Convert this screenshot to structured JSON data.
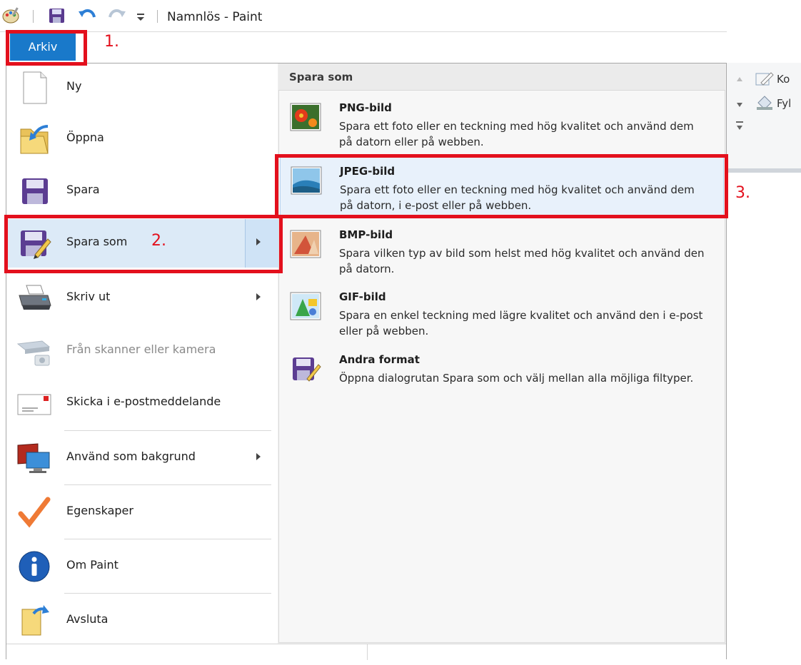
{
  "window": {
    "title": "Namnlös - Paint"
  },
  "tabs": {
    "file_tab": "Arkiv"
  },
  "menu": {
    "items": [
      {
        "label": "Ny",
        "icon": "new-document-icon",
        "submenu": false,
        "enabled": true
      },
      {
        "label": "Öppna",
        "icon": "open-folder-icon",
        "submenu": false,
        "enabled": true
      },
      {
        "label": "Spara",
        "icon": "floppy-disk-icon",
        "submenu": false,
        "enabled": true
      },
      {
        "label": "Spara som",
        "icon": "save-as-icon",
        "submenu": true,
        "enabled": true
      },
      {
        "label": "Skriv ut",
        "icon": "printer-icon",
        "submenu": true,
        "enabled": true
      },
      {
        "label": "Från skanner eller kamera",
        "icon": "scanner-icon",
        "submenu": false,
        "enabled": false
      },
      {
        "label": "Skicka i e-postmeddelande",
        "icon": "email-icon",
        "submenu": false,
        "enabled": true
      },
      {
        "label": "Använd som bakgrund",
        "icon": "desktop-background-icon",
        "submenu": true,
        "enabled": true
      },
      {
        "label": "Egenskaper",
        "icon": "checkmark-icon",
        "submenu": false,
        "enabled": true
      },
      {
        "label": "Om Paint",
        "icon": "info-icon",
        "submenu": false,
        "enabled": true
      },
      {
        "label": "Avsluta",
        "icon": "exit-icon",
        "submenu": false,
        "enabled": true
      }
    ]
  },
  "save_as": {
    "header": "Spara som",
    "options": [
      {
        "title": "PNG-bild",
        "description": "Spara ett foto eller en teckning med hög kvalitet och använd dem på datorn eller på webben.",
        "icon": "png-image-icon"
      },
      {
        "title": "JPEG-bild",
        "description": "Spara ett foto eller en teckning med hög kvalitet och använd dem på datorn, i e-post eller på webben.",
        "icon": "jpeg-image-icon"
      },
      {
        "title": "BMP-bild",
        "description": "Spara vilken typ av bild som helst med hög kvalitet och använd den på datorn.",
        "icon": "bmp-image-icon"
      },
      {
        "title": "GIF-bild",
        "description": "Spara en enkel teckning med lägre kvalitet och använd den i e-post eller på webben.",
        "icon": "gif-image-icon"
      },
      {
        "title": "Andra format",
        "description": "Öppna dialogrutan Spara som och välj mellan alla möjliga filtyper.",
        "icon": "other-formats-icon"
      }
    ]
  },
  "ribbon_partial": {
    "item1": "Ko",
    "item2": "Fyl"
  },
  "annotations": {
    "step1": "1.",
    "step2": "2.",
    "step3": "3."
  },
  "colors": {
    "accent": "#1979ca",
    "annotation_red": "#e3101d",
    "highlight": "#dceaf7"
  }
}
